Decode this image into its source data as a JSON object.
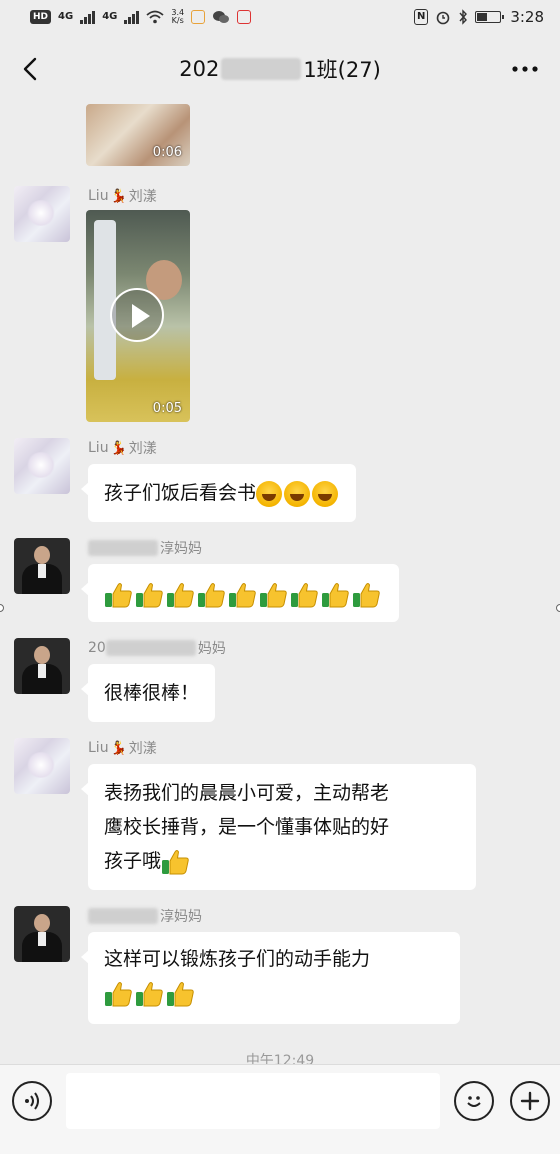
{
  "status_bar": {
    "hd_badge": "HD",
    "net_left": "4G",
    "net_right": "4G",
    "speed_value": "3.4",
    "speed_unit": "K/s",
    "nfc": "N",
    "time": "3:28"
  },
  "header": {
    "title_prefix": "202",
    "title_suffix": "1班(27)",
    "back_icon": "chevron-left-icon",
    "more_icon": "more-dots-icon"
  },
  "messages": [
    {
      "type": "video",
      "duration": "0:06"
    },
    {
      "sender": "Liu",
      "sender_suffix": "刘漾",
      "type": "video",
      "duration": "0:05"
    },
    {
      "sender": "Liu",
      "sender_suffix": "刘漾",
      "type": "text",
      "text": "孩子们饭后看会书",
      "emoji": "laugh-emoji",
      "emoji_count": 3
    },
    {
      "sender_suffix": "淳妈妈",
      "type": "emoji",
      "emoji": "thumbs-up-emoji",
      "emoji_count": 9
    },
    {
      "sender_prefix": "20",
      "sender_suffix": "妈妈",
      "type": "text",
      "text": "很棒很棒！"
    },
    {
      "sender": "Liu",
      "sender_suffix": "刘漾",
      "type": "text",
      "lines": [
        "表扬我们的晨晨小可爱，主动帮老",
        "鹰校长捶背，是一个懂事体贴的好",
        "孩子哦"
      ],
      "emoji": "thumbs-up-emoji",
      "emoji_count": 1
    },
    {
      "sender_suffix": "淳妈妈",
      "type": "text",
      "text": "这样可以锻炼孩子们的动手能力",
      "emoji": "thumbs-up-emoji",
      "emoji_count": 3
    }
  ],
  "timestamp": "中午12:49",
  "input_bar": {
    "voice_icon": "voice-icon",
    "emoji_icon": "emoji-icon",
    "plus_icon": "plus-icon"
  },
  "colors": {
    "background": "#ededed",
    "bubble": "#ffffff",
    "meta_text": "#8a8a8a",
    "thumb_green_cuff": "#2e9b3e",
    "thumb_yellow": "#f7c32e"
  }
}
